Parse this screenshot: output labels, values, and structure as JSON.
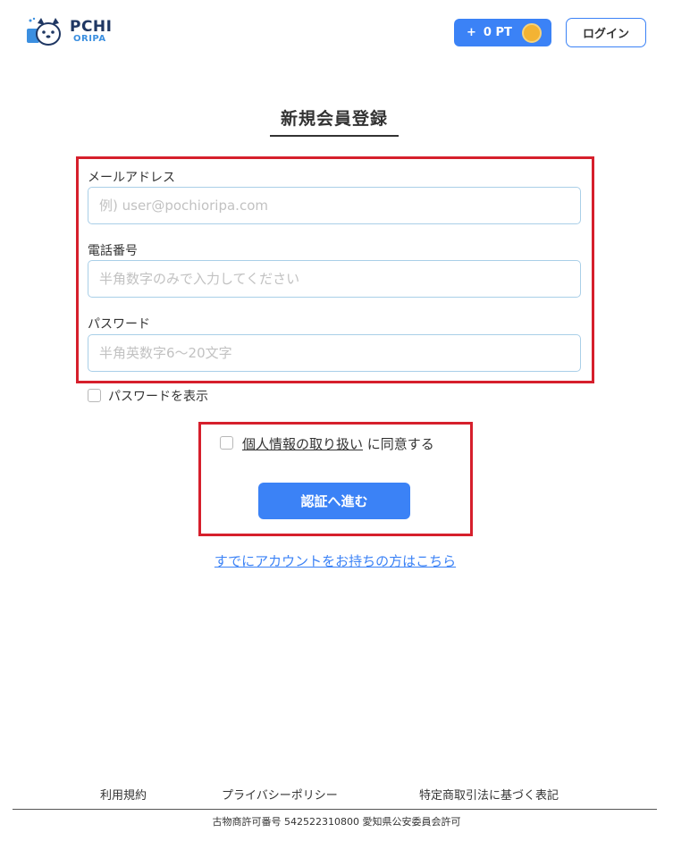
{
  "header": {
    "logo": {
      "line1": "PCHI",
      "line2": "ORIPA"
    },
    "points_button": {
      "plus": "+",
      "label": "0 PT"
    },
    "login_label": "ログイン"
  },
  "page_title": "新規会員登録",
  "form": {
    "email": {
      "label": "メールアドレス",
      "placeholder": "例) user@pochioripa.com",
      "value": ""
    },
    "phone": {
      "label": "電話番号",
      "placeholder": "半角数字のみで入力してください",
      "value": ""
    },
    "password": {
      "label": "パスワード",
      "placeholder": "半角英数字6〜20文字",
      "value": ""
    },
    "show_password_label": "パスワードを表示"
  },
  "consent": {
    "link_text": "個人情報の取り扱い",
    "suffix": "に同意する"
  },
  "submit_label": "認証へ進む",
  "existing_account_link": "すでにアカウントをお持ちの方はこちら",
  "footer": {
    "links": [
      "利用規約",
      "プライバシーポリシー",
      "特定商取引法に基づく表記"
    ],
    "license": "古物商許可番号 542522310800 愛知県公安委員会許可"
  },
  "colors": {
    "accent": "#3b82f6",
    "highlight": "#d61f2c",
    "coin": "#f3b333"
  }
}
